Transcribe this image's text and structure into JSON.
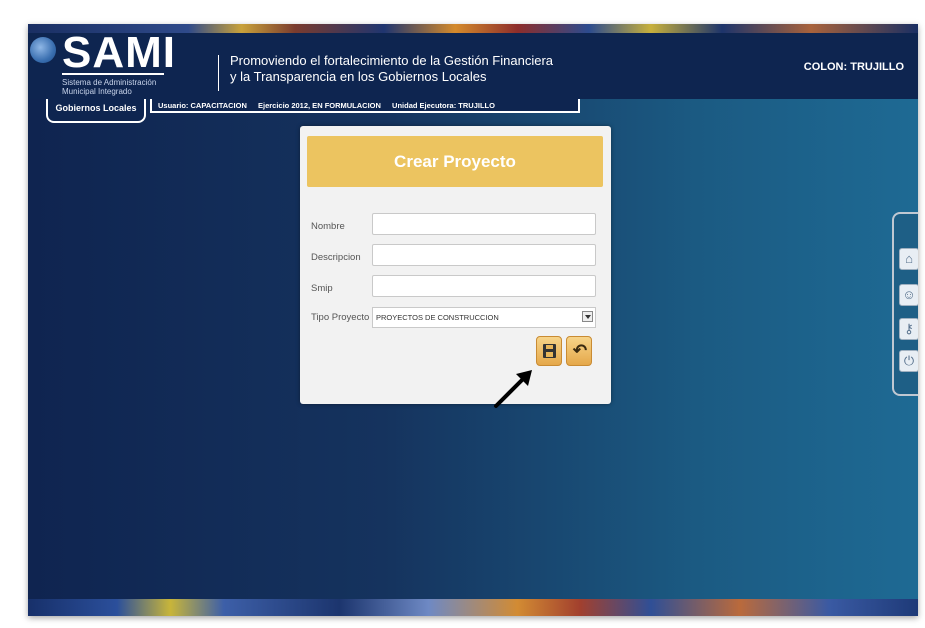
{
  "header": {
    "logo_text": "SAMI",
    "logo_subtitle_line1": "Sistema de Administración",
    "logo_subtitle_line2": "Municipal Integrado",
    "tagline_line1": "Promoviendo el fortalecimiento de la Gestión Financiera",
    "tagline_line2": "y la Transparencia en los Gobiernos Locales",
    "municipality": "COLON: TRUJILLO"
  },
  "tabs": {
    "active_tab": "Gobiernos Locales",
    "usuario": "Usuario: CAPACITACION",
    "ejercicio": "Ejercicio 2012, EN FORMULACION",
    "unidad": "Unidad Ejecutora: TRUJILLO"
  },
  "form": {
    "title": "Crear Proyecto",
    "nombre_label": "Nombre",
    "nombre_value": "",
    "descripcion_label": "Descripcion",
    "descripcion_value": "",
    "smip_label": "Smip",
    "smip_value": "",
    "tipo_label": "Tipo Proyecto",
    "tipo_selected": "PROYECTOS DE CONSTRUCCION"
  },
  "side_icons": [
    "home-icon",
    "user-icon",
    "key-icon",
    "power-icon"
  ],
  "colors": {
    "header_bg": "#0e2550",
    "card_header": "#ecc460",
    "button_gold": "#e5a84a"
  }
}
